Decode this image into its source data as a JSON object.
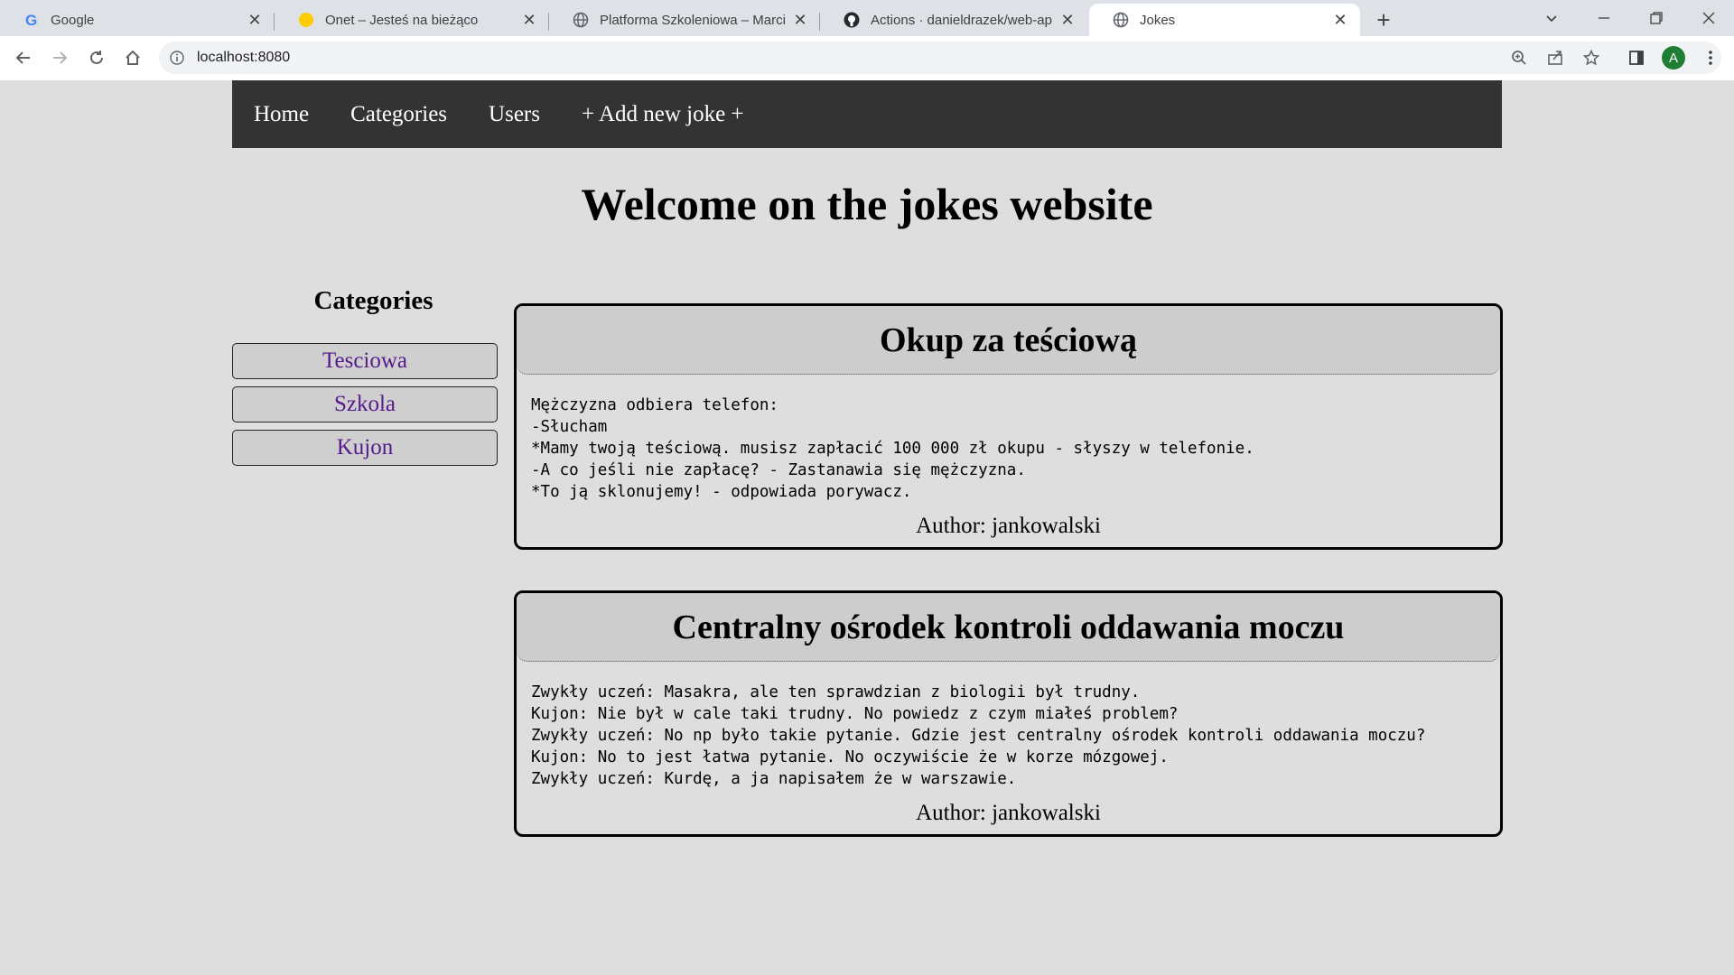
{
  "browser": {
    "tabs": [
      {
        "title": "Google",
        "icon": "google-icon",
        "active": false
      },
      {
        "title": "Onet – Jesteś na bieżąco",
        "icon": "onet-icon",
        "active": false
      },
      {
        "title": "Platforma Szkoleniowa – Marcin",
        "icon": "globe-icon",
        "active": false
      },
      {
        "title": "Actions · danieldrazek/web-app-j",
        "icon": "github-icon",
        "active": false
      },
      {
        "title": "Jokes",
        "icon": "globe-icon",
        "active": true
      }
    ],
    "url": "localhost:8080",
    "profile_initial": "A"
  },
  "site": {
    "nav": [
      "Home",
      "Categories",
      "Users",
      "+ Add new joke +"
    ],
    "heading": "Welcome on the jokes website",
    "categories_title": "Categories",
    "categories": [
      "Tesciowa",
      "Szkola",
      "Kujon"
    ],
    "jokes": [
      {
        "title": "Okup za teściową",
        "lines": [
          "Mężczyzna odbiera telefon:",
          "-Słucham",
          "*Mamy twoją teściową. musisz zapłacić 100 000 zł okupu - słyszy w telefonie.",
          "-A co jeśli nie zapłacę? - Zastanawia się mężczyzna.",
          "*To ją sklonujemy! - odpowiada porywacz."
        ],
        "author": "Author: jankowalski"
      },
      {
        "title": "Centralny ośrodek kontroli oddawania moczu",
        "lines": [
          "Zwykły uczeń: Masakra, ale ten sprawdzian z biologii był trudny.",
          "Kujon: Nie był w cale taki trudny. No powiedz z czym miałeś problem?",
          "Zwykły uczeń: No np było takie pytanie. Gdzie jest centralny ośrodek kontroli oddawania moczu?",
          "Kujon: No to jest łatwa pytanie. No oczywiście że w korze mózgowej.",
          "Zwykły uczeń: Kurdę, a ja napisałem że w warszawie."
        ],
        "author": "Author: jankowalski"
      }
    ]
  }
}
